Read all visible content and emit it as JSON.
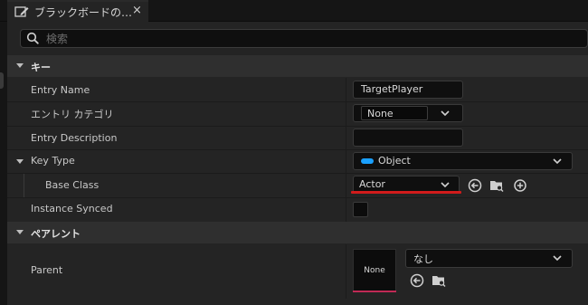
{
  "tab": {
    "title": "ブラックボードの…",
    "close": "×"
  },
  "search": {
    "placeholder": "検索"
  },
  "categories": {
    "keys": "キー",
    "parent": "ペアレント"
  },
  "properties": {
    "entry_name": {
      "label": "Entry Name",
      "value": "TargetPlayer"
    },
    "entry_category": {
      "label": "エントリ カテゴリ",
      "value": "None"
    },
    "entry_description": {
      "label": "Entry Description",
      "value": ""
    },
    "key_type": {
      "label": "Key Type",
      "value": "Object",
      "accent_color": "#1aa0ff"
    },
    "base_class": {
      "label": "Base Class",
      "value": "Actor",
      "highlight_color": "#d11b1b"
    },
    "instance_synced": {
      "label": "Instance Synced",
      "checked": false
    },
    "parent": {
      "label": "Parent",
      "thumbnail_label": "None",
      "value": "なし",
      "thumbnail_bar_color": "#c02a55"
    }
  },
  "icons": {
    "tab": "blackboard-edit-icon",
    "search": "search-icon",
    "use_selected": "arrow-left-circle-icon",
    "browse": "folder-search-icon",
    "add": "plus-circle-icon"
  }
}
